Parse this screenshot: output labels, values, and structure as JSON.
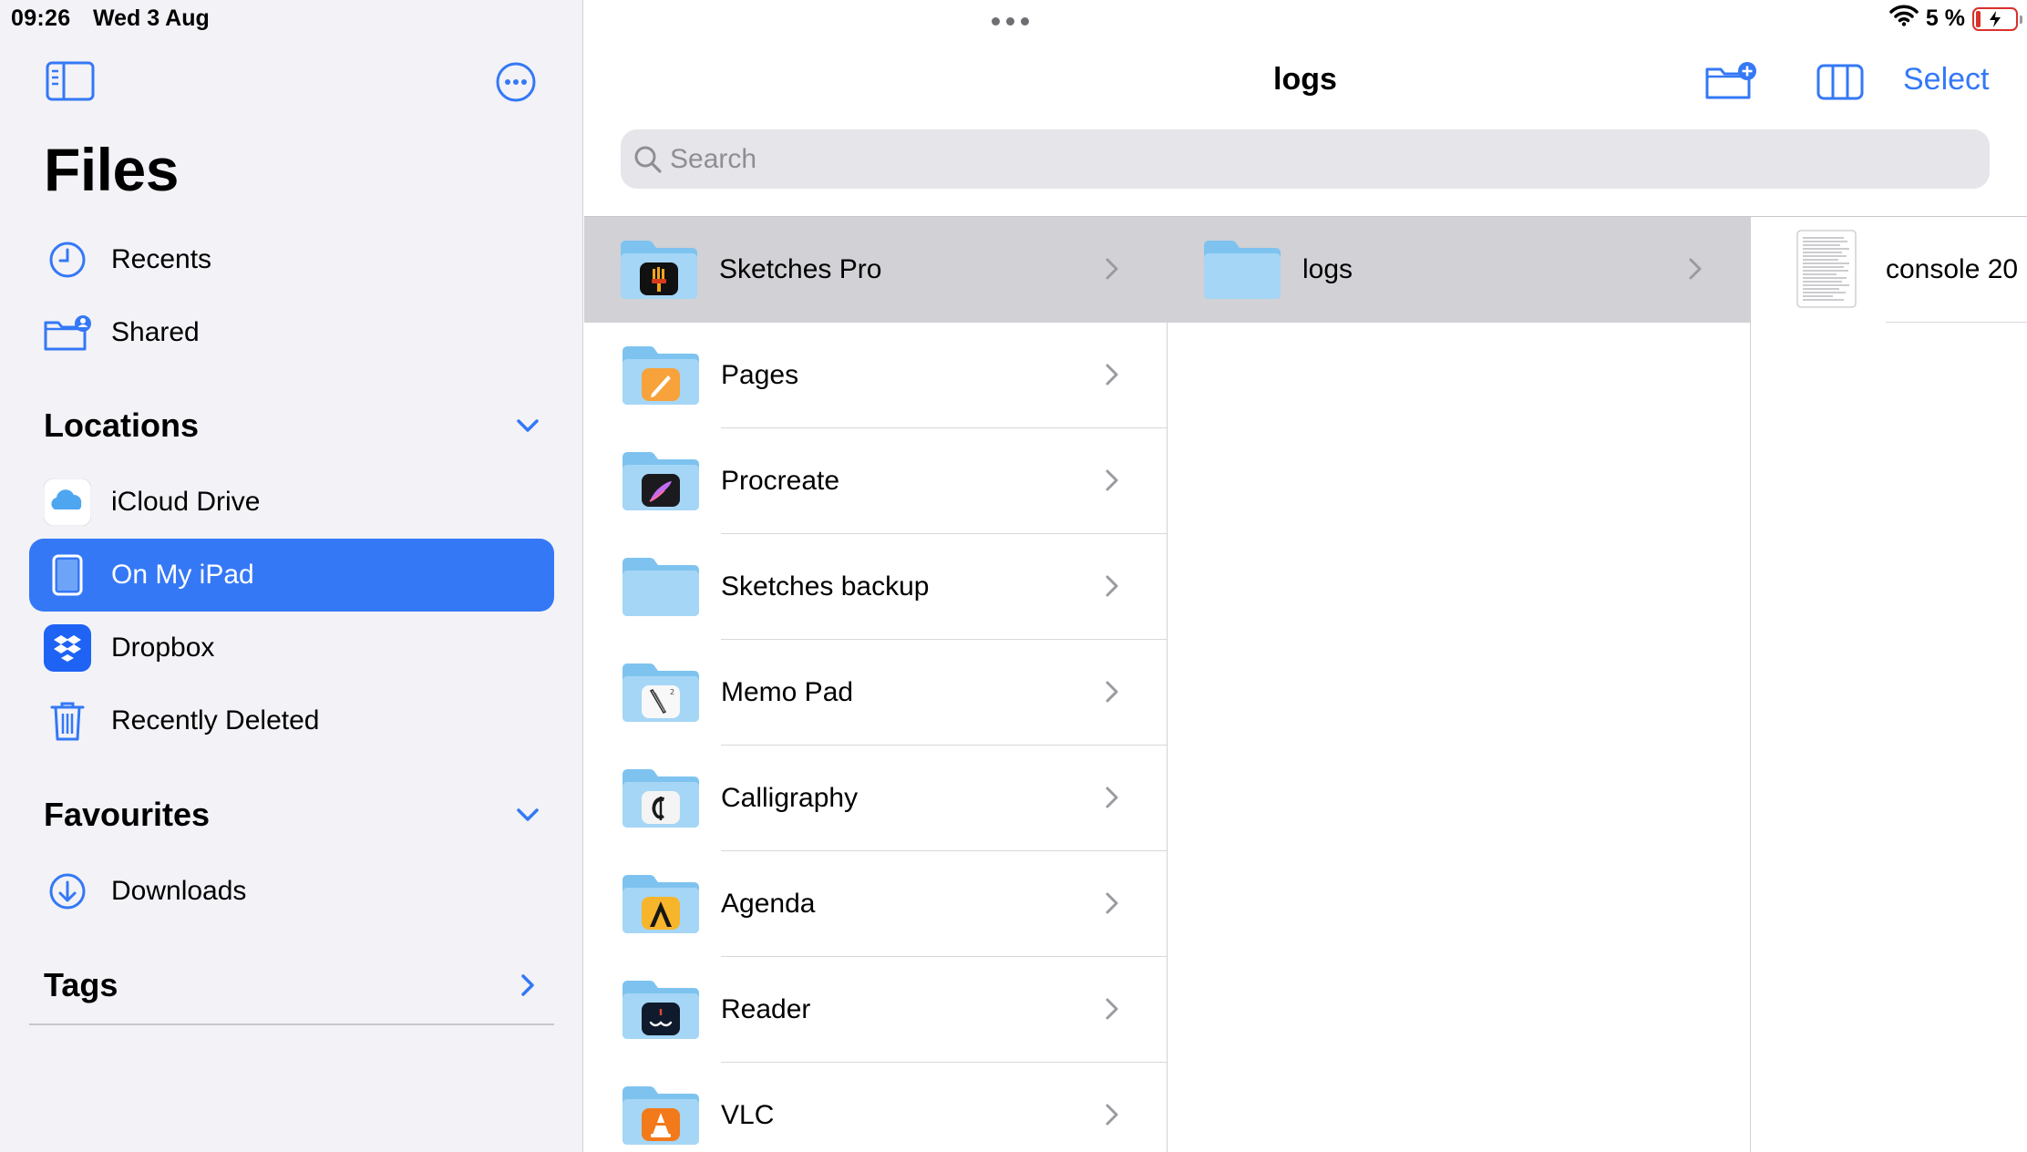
{
  "status_bar": {
    "time": "09:26",
    "date": "Wed 3 Aug",
    "battery": "5 %"
  },
  "sidebar": {
    "title": "Files",
    "top_items": [
      {
        "label": "Recents",
        "icon": "clock-icon"
      },
      {
        "label": "Shared",
        "icon": "shared-folder-icon"
      }
    ],
    "locations": {
      "header": "Locations",
      "items": [
        {
          "label": "iCloud Drive",
          "icon": "icloud-icon"
        },
        {
          "label": "On My iPad",
          "icon": "ipad-icon",
          "selected": true
        },
        {
          "label": "Dropbox",
          "icon": "dropbox-icon"
        },
        {
          "label": "Recently Deleted",
          "icon": "trash-icon"
        }
      ]
    },
    "favourites": {
      "header": "Favourites",
      "items": [
        {
          "label": "Downloads",
          "icon": "download-icon"
        }
      ]
    },
    "tags": {
      "header": "Tags"
    }
  },
  "header": {
    "title": "logs",
    "select_label": "Select",
    "search_placeholder": "Search"
  },
  "columns": {
    "col1": [
      {
        "name": "Sketches Pro",
        "app_icon": "sketches-pro-icon",
        "selected": true
      },
      {
        "name": "Pages",
        "app_icon": "pages-icon"
      },
      {
        "name": "Procreate",
        "app_icon": "procreate-icon"
      },
      {
        "name": "Sketches backup",
        "app_icon": ""
      },
      {
        "name": "Memo Pad",
        "app_icon": "memo-pad-icon"
      },
      {
        "name": "Calligraphy",
        "app_icon": "calligraphy-icon"
      },
      {
        "name": "Agenda",
        "app_icon": "agenda-icon"
      },
      {
        "name": "Reader",
        "app_icon": "reader-icon"
      },
      {
        "name": "VLC",
        "app_icon": "vlc-icon"
      }
    ],
    "col2": [
      {
        "name": "logs",
        "selected": true
      }
    ],
    "col3": [
      {
        "name": "console 20"
      }
    ]
  },
  "colors": {
    "accent": "#3478f6",
    "sidebar_bg": "#f2f2f7",
    "selected_row": "#d1d1d6",
    "folder": "#9fd3f5"
  }
}
